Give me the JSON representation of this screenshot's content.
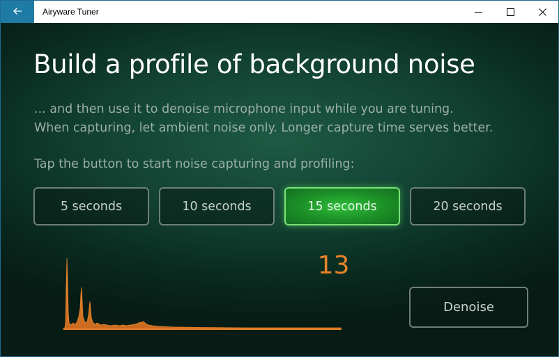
{
  "titlebar": {
    "app_title": "Airyware Tuner",
    "back_icon": "arrow-left-icon",
    "controls": [
      "minimize-icon",
      "maximize-icon",
      "close-icon"
    ]
  },
  "main": {
    "headline": "Build a profile of background noise",
    "subtext_line1": "... and then use it to denoise microphone input while you are tuning.",
    "subtext_line2": "When capturing, let ambient noise only. Longer capture time serves better.",
    "prompt": "Tap the button to start noise capturing and profiling:",
    "durations": [
      {
        "label": "5 seconds",
        "selected": false
      },
      {
        "label": "10 seconds",
        "selected": false
      },
      {
        "label": "15 seconds",
        "selected": true
      },
      {
        "label": "20 seconds",
        "selected": false
      }
    ],
    "countdown": "13",
    "denoise_label": "Denoise"
  },
  "colors": {
    "accent_titlebar": "#1e7ba5",
    "selected_button": "#2fbf3a",
    "countdown": "#e8832a",
    "spectrum": "#e8832a"
  }
}
